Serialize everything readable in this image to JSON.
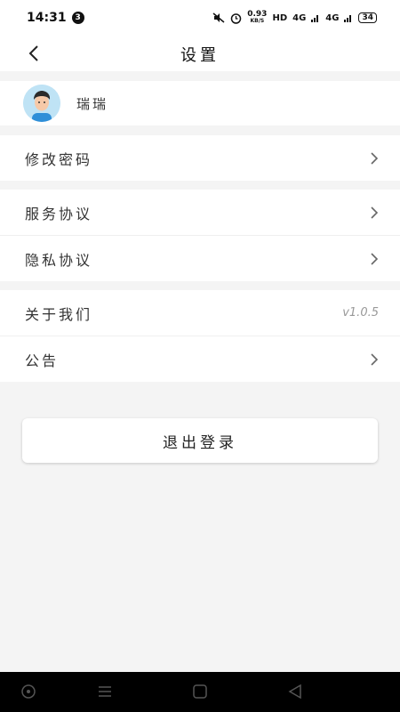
{
  "status_bar": {
    "time": "14:31",
    "notification_count": "3",
    "net_speed": "0.93",
    "net_unit": "KB/S",
    "hd": "HD",
    "signal1": "4G",
    "signal2": "4G",
    "battery": "34"
  },
  "header": {
    "title": "设置"
  },
  "profile": {
    "username": "瑞瑞"
  },
  "settings": {
    "change_password": "修改密码",
    "service_agreement": "服务协议",
    "privacy_agreement": "隐私协议",
    "about_us": "关于我们",
    "version": "v1.0.5",
    "announcement": "公告"
  },
  "actions": {
    "logout": "退出登录"
  },
  "colors": {
    "background": "#f4f4f4",
    "card": "#ffffff",
    "text": "#333333",
    "muted": "#999999"
  }
}
